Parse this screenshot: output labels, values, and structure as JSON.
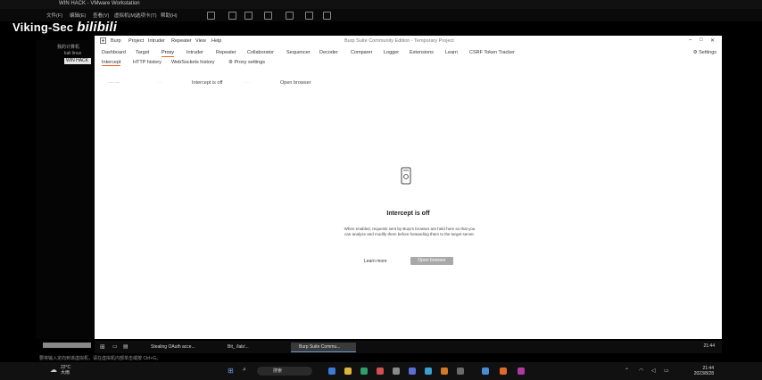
{
  "vm": {
    "title": "WIN HACK - VMware Workstation",
    "menu": [
      "文件(F)",
      "编辑(E)",
      "查看(V)",
      "虚拟机(M)",
      "选项卡(T)",
      "帮助(H)"
    ],
    "library_items": [
      "我的计算机",
      "kali linux",
      "WIN HACK"
    ],
    "library_selected": "WIN HACK"
  },
  "watermark": {
    "text": "Viking-Sec",
    "logo": "bilibili"
  },
  "burp": {
    "menu": [
      "Burp",
      "Project",
      "Intruder",
      "Repeater",
      "View",
      "Help"
    ],
    "window_title": "Burp Suite Community Edition - Temporary Project",
    "tabs": [
      "Dashboard",
      "Target",
      "Proxy",
      "Intruder",
      "Repeater",
      "Collaborator",
      "Sequencer",
      "Decoder",
      "Comparer",
      "Logger",
      "Extensions",
      "Learn",
      "CSRF Token Tracker"
    ],
    "active_tab": "Proxy",
    "settings_label": "Settings",
    "subtabs": [
      "Intercept",
      "HTTP history",
      "WebSockets history",
      "Proxy settings"
    ],
    "active_subtab": "Intercept",
    "toolbar": {
      "intercept_toggle": "Intercept is off",
      "open_browser": "Open browser"
    },
    "hero": {
      "title": "Intercept is off",
      "description": "When enabled, requests sent by Burp's browser are held here so that you can analyze and modify them before forwarding them to the target server.",
      "learn_more": "Learn more",
      "open_browser": "Open browser"
    }
  },
  "vm_taskbar": {
    "items": [
      "Stealing OAuth acce...",
      "Bit_ /lab/...",
      "Burp Suite Commu..."
    ],
    "active_index": 2,
    "clock": "21:44"
  },
  "statusbar": {
    "text": "要将输入定向到该虚拟机，请在虚拟机内部单击或按 Ctrl+G。"
  },
  "host_taskbar": {
    "weather_temp": "22°C",
    "weather_desc": "大雨",
    "search_placeholder": "搜索",
    "time": "21:44",
    "date": "2023/8/28"
  },
  "colors": {
    "accent": "#e86a2b",
    "button_gray": "#a8a8a8"
  }
}
